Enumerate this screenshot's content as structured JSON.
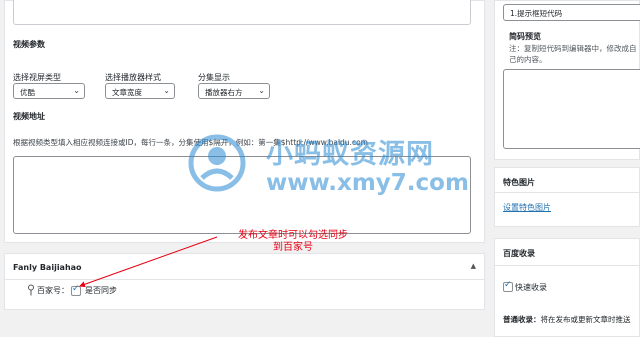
{
  "video_panel": {
    "section_title": "视频参数",
    "viewport_label": "选择视屏类型",
    "viewport_value": "优酷",
    "player_label": "选择播放器样式",
    "player_value": "文章宽度",
    "share_label": "分集显示",
    "share_value": "播放器右方",
    "address_title": "视频地址",
    "address_hint": "根据视频类型填入相应视频连接或ID，每行一条，分集使用$隔开，例如：第一集$http://www.baidu.com"
  },
  "baijiahao_panel": {
    "title": "Fanly Baijiahao",
    "toggle_icon": "triangle-up",
    "field_label": "百家号：",
    "sync_label": "是否同步",
    "sync_checked": true
  },
  "annotation": {
    "line1": "发布文章时可以勾选同步",
    "line2": "到百家号",
    "color": "#e60012"
  },
  "sidebar": {
    "shortcode_input_value": "1.提示框短代码",
    "preview_title": "简码预览",
    "preview_hint": "注：复制短代码到编辑器中，修改成自己的内容。",
    "featured_title": "特色图片",
    "featured_link": "设置特色图片",
    "baidu_title": "百度收录",
    "fast_label": "快速收录",
    "fast_checked": true,
    "normal_label": "普通收录：",
    "normal_text": "将在发布或更新文章时推送"
  },
  "watermark": {
    "title": "小蚂蚁资源网",
    "url": "www.xmy7.com",
    "color": "#2a8ad2"
  }
}
